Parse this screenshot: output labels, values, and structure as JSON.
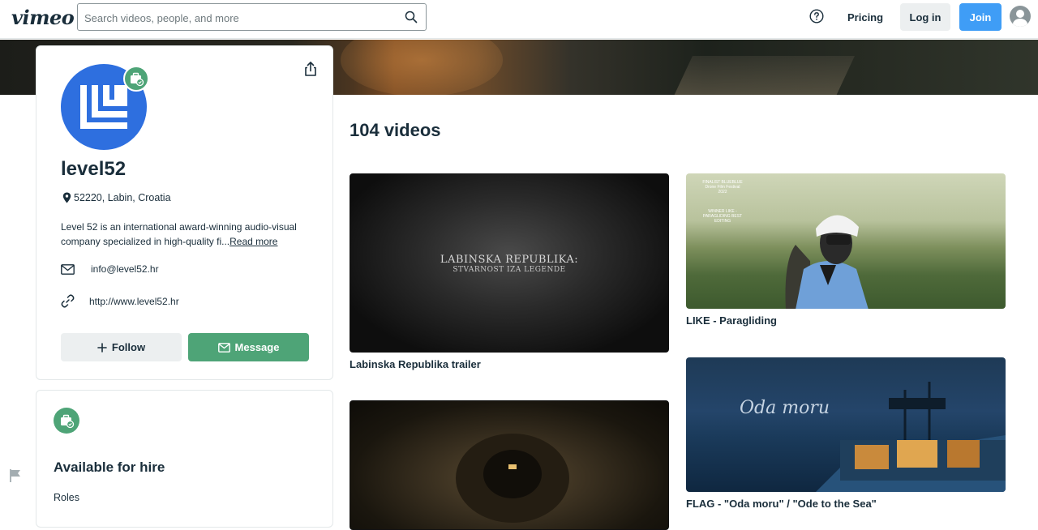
{
  "header": {
    "logo": "vimeo",
    "search_placeholder": "Search videos, people, and more",
    "pricing": "Pricing",
    "login": "Log in",
    "join": "Join"
  },
  "profile": {
    "name": "level52",
    "location": "52220, Labin, Croatia",
    "bio": "Level 52 is an international award-winning audio-visual company specialized in high-quality fi...",
    "read_more": "Read more",
    "email": "info@level52.hr",
    "website": "http://www.level52.hr",
    "follow": "Follow",
    "message": "Message"
  },
  "hire": {
    "title": "Available for hire",
    "roles_label": "Roles"
  },
  "videos": {
    "count_label": "104 videos",
    "items": [
      {
        "title": "Labinska Republika trailer",
        "thumb_title": "LABINSKA REPUBLIKA:",
        "thumb_subtitle": "STVARNOST IZA LEGENDE"
      },
      {
        "title": "LIKE - Paragliding",
        "laurel_top": "FINALIST BLUEBLUE Drone Film Festival 2022",
        "laurel_bottom": "WINNER LIKE - PARAGLIDING BEST EDITING"
      },
      {
        "title": "FLAG - \"Oda moru\" / \"Ode to the Sea\"",
        "thumb_title": "Oda moru"
      },
      {
        "title": ""
      }
    ]
  },
  "colors": {
    "brand_green": "#4ea477",
    "join_blue": "#3f9df6",
    "avatar_blue": "#2e6fdf",
    "text_dark": "#1a2e3b"
  }
}
